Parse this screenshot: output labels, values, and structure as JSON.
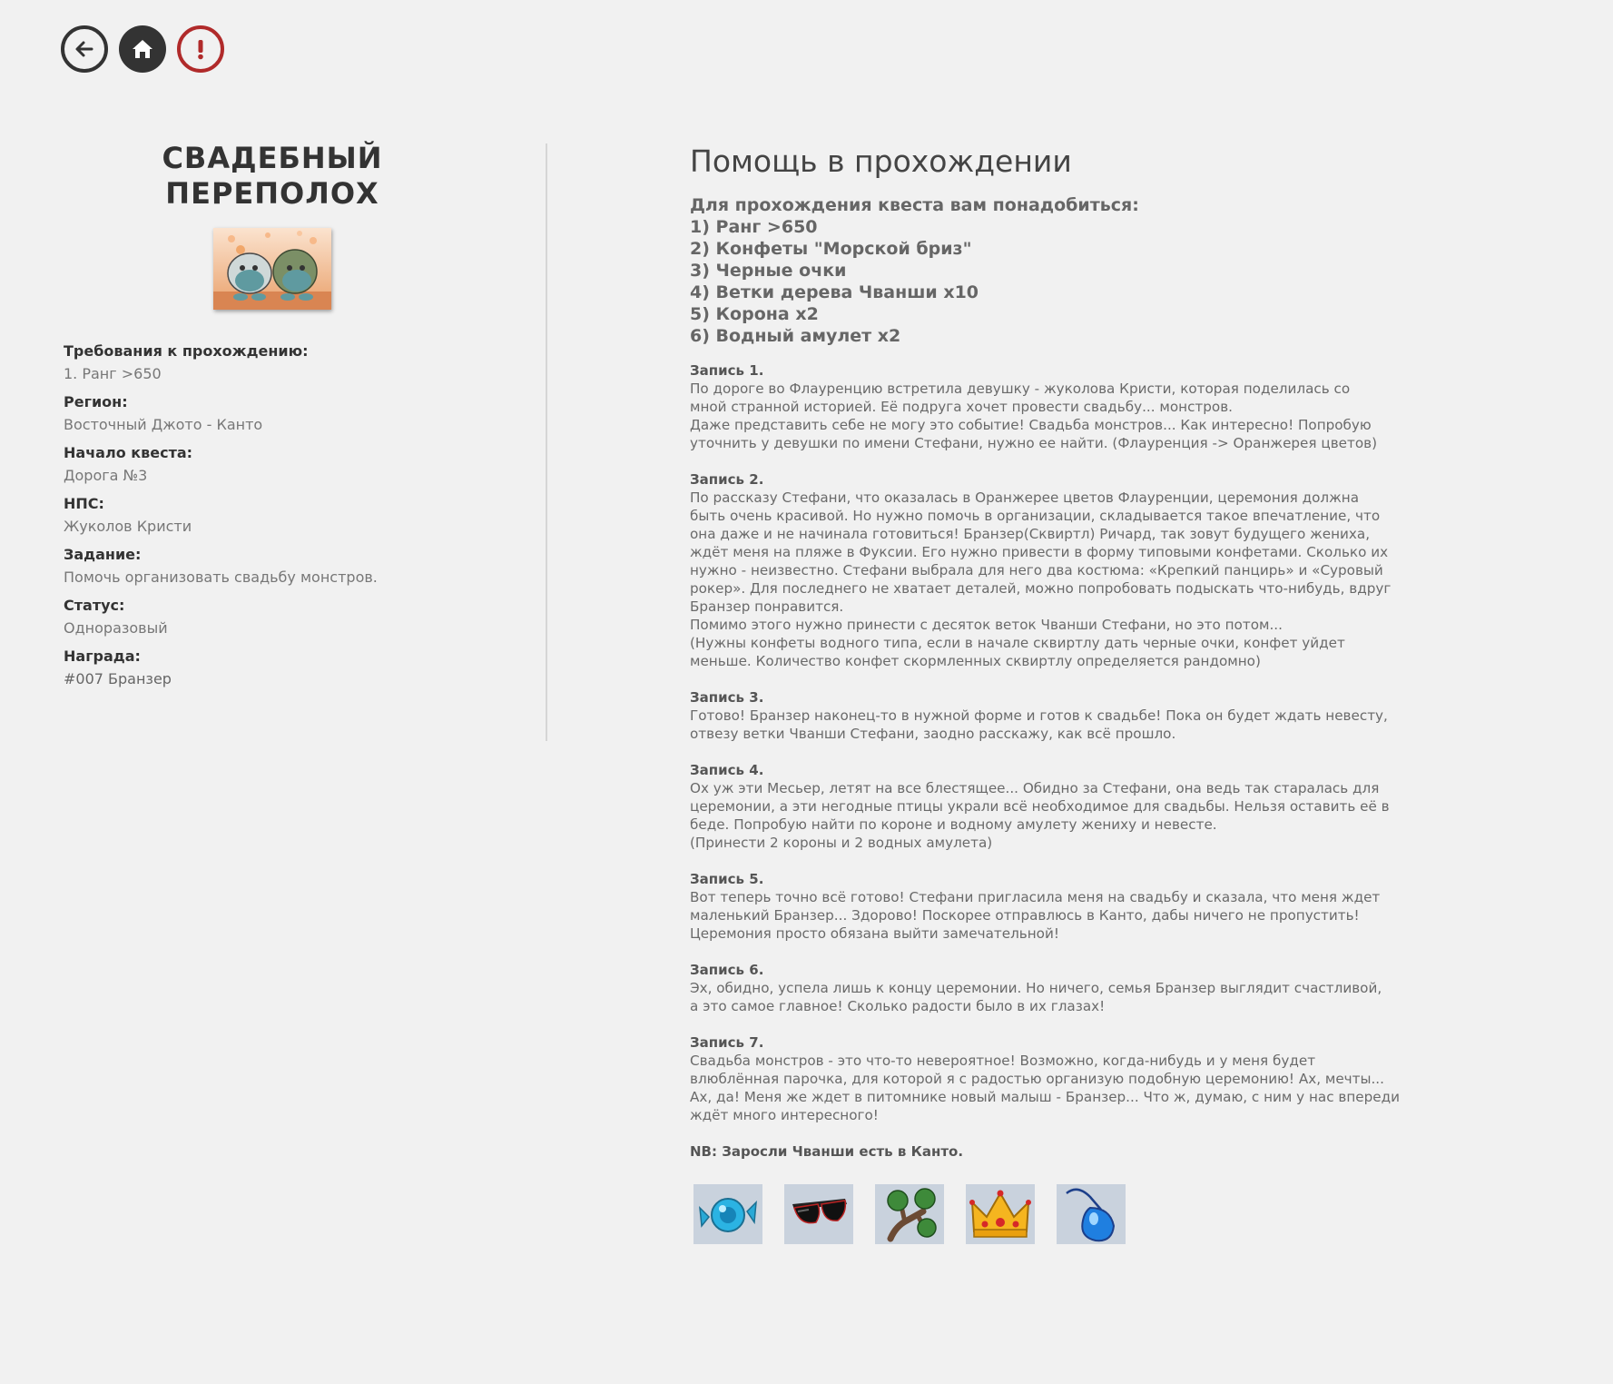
{
  "nav": {
    "back_icon": "arrow-left-icon",
    "home_icon": "home-icon",
    "alert_icon": "exclamation-icon"
  },
  "quest": {
    "title": "СВАДЕБНЫЙ ПЕРЕПОЛОХ",
    "fields": [
      {
        "label": "Требования к прохождению:",
        "value": "1. Ранг >650"
      },
      {
        "label": "Регион:",
        "value": "Восточный Джото - Канто"
      },
      {
        "label": "Начало квеста:",
        "value": "Дорога №3"
      },
      {
        "label": "НПС:",
        "value": "Жуколов Кристи"
      },
      {
        "label": "Задание:",
        "value": "Помочь организовать свадьбу монстров."
      },
      {
        "label": "Статус:",
        "value": "Одноразовый"
      },
      {
        "label": "Награда:",
        "value": "#007 Бранзер"
      }
    ]
  },
  "help": {
    "title": "Помощь в прохождении",
    "requirements": [
      "Для прохождения квеста вам понадобиться:",
      "1) Ранг >650",
      "2) Конфеты \"Морской бриз\"",
      "3) Черные очки",
      "4) Ветки дерева Чванши x10",
      "5) Корона x2",
      "6) Водный амулет x2"
    ],
    "entries": [
      {
        "title": "Запись 1.",
        "text": "По дороге во Флауренцию встретила девушку - жуколова Кристи, которая поделилась со\nмной странной историей. Её подруга хочет провести свадьбу... монстров.\nДаже представить себе не могу это событие! Свадьба монстров... Как интересно! Попробую\nуточнить у девушки по имени Стефани, нужно ее найти. (Флауренция -> Оранжерея цветов)"
      },
      {
        "title": "Запись 2.",
        "text": "По рассказу Стефани, что оказалась в Оранжерее цветов Флауренции, церемония должна\nбыть очень красивой. Но нужно помочь в организации, складывается такое впечатление, что\nона даже и не начинала готовиться! Бранзер(Сквиртл) Ричард, так зовут будущего жениха,\nждёт меня на пляже в Фуксии. Его нужно привести в форму типовыми конфетами. Сколько их\nнужно - неизвестно. Стефани выбрала для него два костюма: «Крепкий панцирь» и «Суровый\nрокер». Для последнего не хватает деталей, можно попробовать подыскать что-нибудь, вдруг\nБранзер понравится.\nПомимо этого нужно принести с десяток веток Чванши Стефани, но это потом...\n(Нужны конфеты водного типа, если в начале сквиртлу дать черные очки, конфет уйдет\nменьше. Количество конфет скормленных сквиртлу определяется рандомно)"
      },
      {
        "title": "Запись 3.",
        "text": "Готово! Бранзер наконец-то в нужной форме и готов к свадьбе! Пока он будет ждать невесту,\nотвезу ветки Чванши Стефани, заодно расскажу, как всё прошло."
      },
      {
        "title": "Запись 4.",
        "text": "Ох уж эти Месьер, летят на все блестящее... Обидно за Стефани, она ведь так старалась для\nцеремонии, а эти негодные птицы украли всё необходимое для свадьбы. Нельзя оставить её в\nбеде. Попробую найти по короне и водному амулету жениху и невесте.\n(Принести 2 короны и 2 водных амулета)"
      },
      {
        "title": "Запись 5.",
        "text": "Вот теперь точно всё готово! Стефани пригласила меня на свадьбу и сказала, что меня ждет\nмаленький Бранзер... Здорово! Поскорее отправлюсь в Канто, дабы ничего не пропустить!\nЦеремония просто обязана выйти замечательной!"
      },
      {
        "title": "Запись 6.",
        "text": "Эх, обидно, успела лишь к концу церемонии. Но ничего, семья Бранзер выглядит счастливой,\nа это самое главное! Сколько радости было в их глазах!"
      },
      {
        "title": "Запись 7.",
        "text": "Свадьба монстров - это что-то невероятное! Возможно, когда-нибудь и у меня будет\nвлюблённая парочка, для которой я с радостью организую подобную церемонию! Ах, мечты...\nАх, да! Меня же ждет в питомнике новый малыш - Бранзер... Что ж, думаю, с ним у нас впереди\nждёт много интересного!"
      }
    ],
    "nb": "NB: Заросли Чванши есть в Канто.",
    "items": [
      "candy-icon",
      "sunglasses-icon",
      "branch-icon",
      "crown-icon",
      "water-amulet-icon"
    ]
  },
  "colors": {
    "background": "#f1f1f1",
    "dark": "#333333",
    "alert": "#b02a2a",
    "item_bg": "#c9d2dd"
  }
}
